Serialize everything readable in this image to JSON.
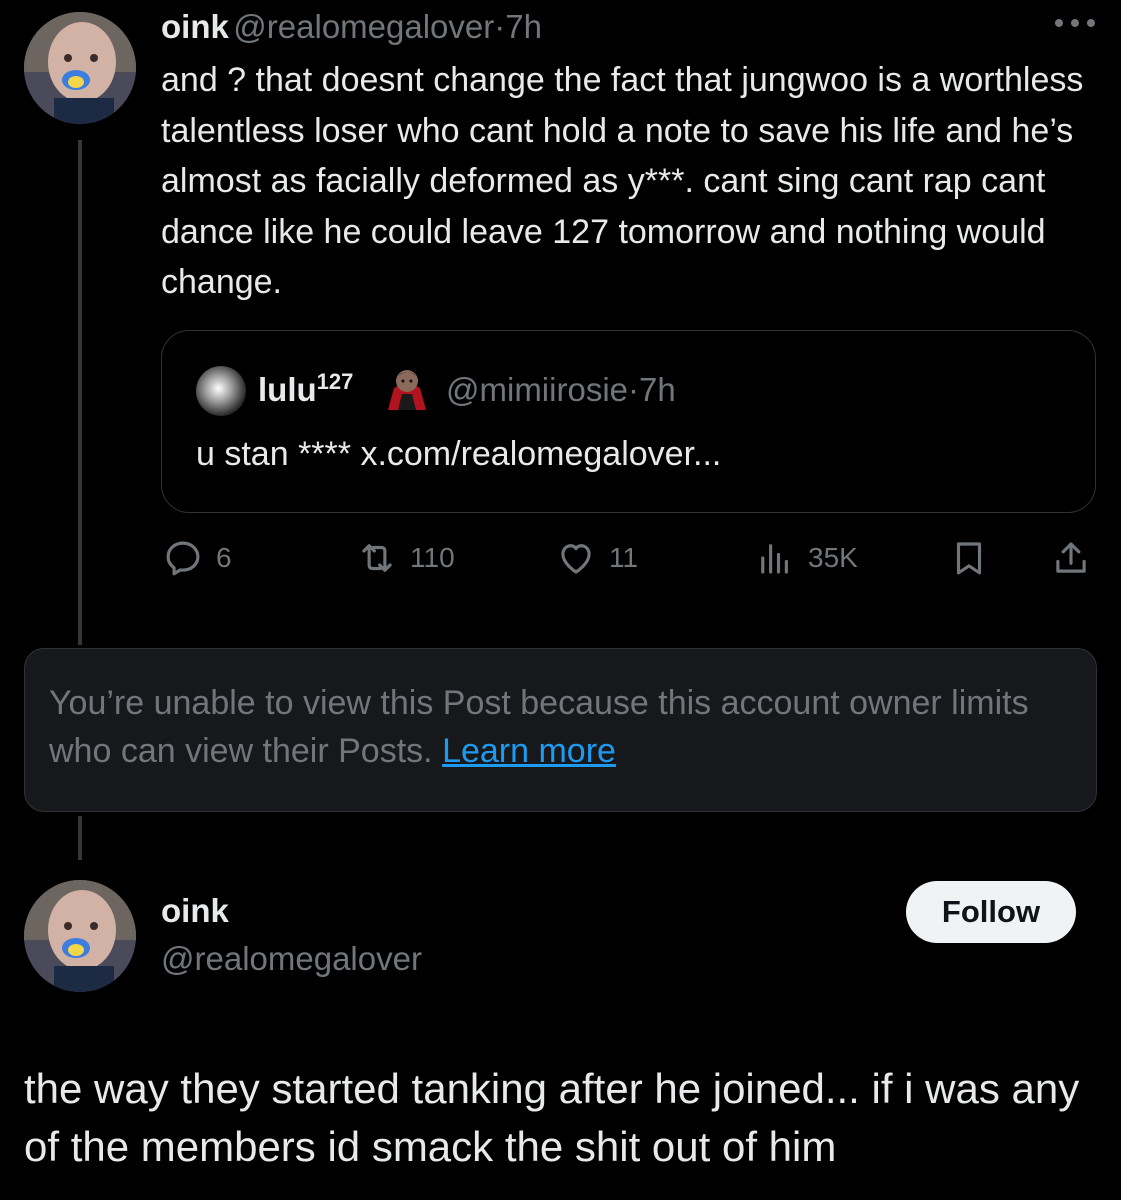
{
  "parent_post": {
    "author_name": "oink",
    "author_handle": "@realomegalover",
    "separator": "·",
    "time": "7h",
    "text": "and ? that doesnt change the fact that jungwoo is a worthless talentless loser who cant hold a note to save his life and he’s almost as facially deformed as y***. cant sing cant rap cant dance like he could leave 127 tomorrow and nothing would change.",
    "quote": {
      "author_name": "lulu",
      "author_name_sup": "127",
      "author_handle": "@mimiirosie",
      "separator": "·",
      "time": "7h",
      "text": "u stan **** x.com/realomegalover..."
    },
    "actions": {
      "replies": "6",
      "reposts": "110",
      "likes": "11",
      "views": "35K"
    }
  },
  "restricted_notice": {
    "text": "You’re unable to view this Post because this account owner limits who can view their Posts.",
    "link_label": "Learn more"
  },
  "main_post": {
    "author_name": "oink",
    "author_handle": "@realomegalover",
    "follow_label": "Follow",
    "text": "the way they started tanking after he joined... if i was any of the members id smack the shit out of him"
  },
  "colors": {
    "background": "#000000",
    "text_primary": "#e7e9ea",
    "text_secondary": "#71767b",
    "link": "#1d9bf0",
    "border": "#2f3336",
    "notice_bg": "#16181c",
    "follow_bg": "#eff3f4"
  },
  "icons": [
    "more-icon",
    "reply-icon",
    "repost-icon",
    "like-icon",
    "views-icon",
    "bookmark-icon",
    "share-icon",
    "vampire-emoji-icon"
  ]
}
